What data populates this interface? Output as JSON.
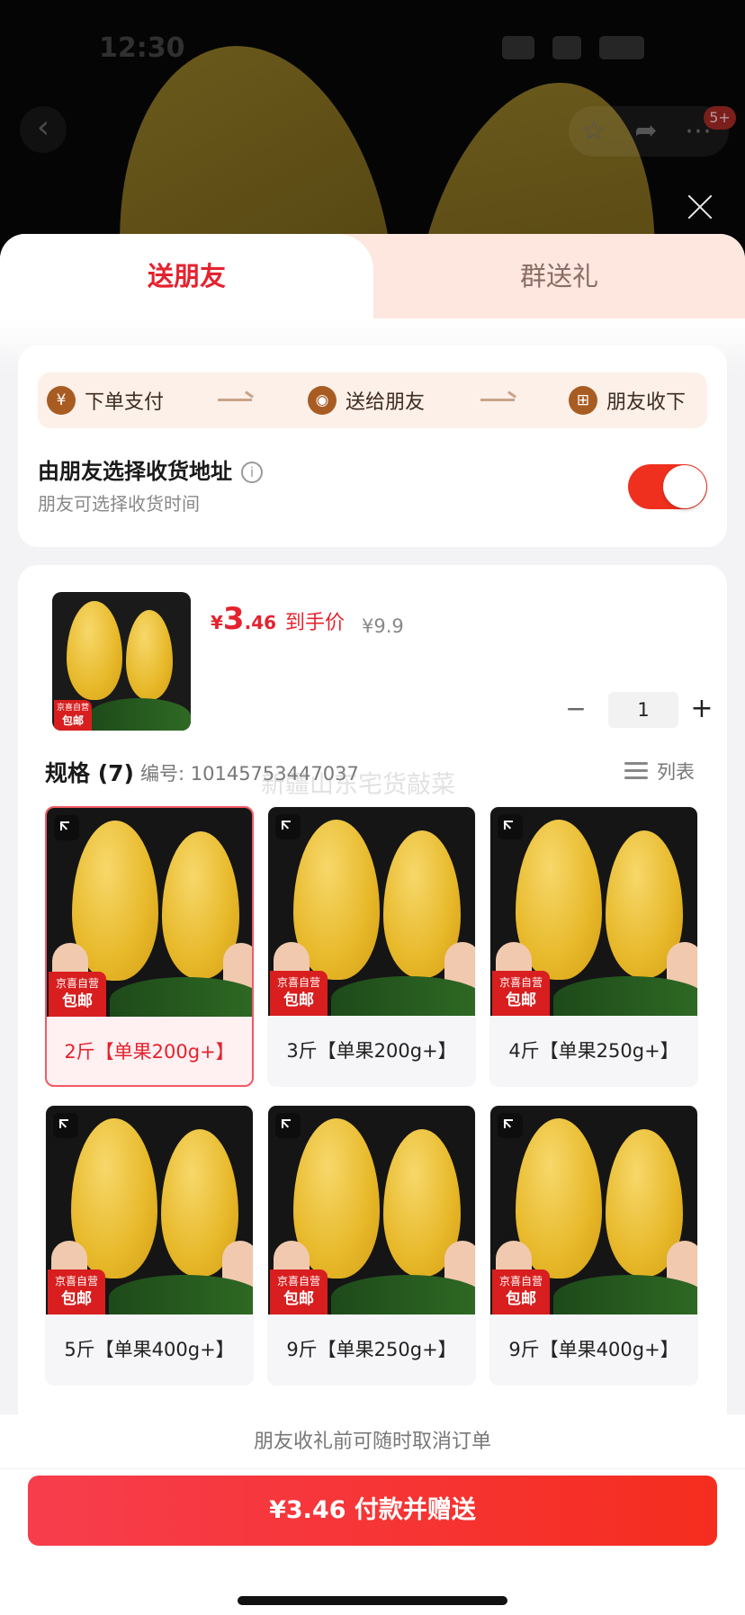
{
  "status_bar": {
    "time": "12:30"
  },
  "background": {
    "cart_badge": "5+"
  },
  "tabs": [
    {
      "label": "送朋友",
      "active": true
    },
    {
      "label": "群送礼",
      "active": false
    }
  ],
  "flow": [
    {
      "icon": "yen-circle-icon",
      "glyph": "¥",
      "label": "下单支付"
    },
    {
      "icon": "wechat-icon",
      "glyph": "◉",
      "label": "送给朋友"
    },
    {
      "icon": "gift-icon",
      "glyph": "⊞",
      "label": "朋友收下"
    }
  ],
  "address": {
    "title": "由朋友选择收货地址",
    "subtitle": "朋友可选择收货时间",
    "toggle_on": true
  },
  "product": {
    "price_currency": "¥",
    "price_int": "3",
    "price_dec": ".46",
    "price_label": "到手价",
    "original_price": "¥9.9",
    "quantity": "1",
    "qty_minus": "−",
    "qty_plus": "+"
  },
  "spec": {
    "title": "规格 (7)",
    "id_label": "编号: 10145753447037",
    "list_label": "列表",
    "watermark": "新疆山东宅货敲菜"
  },
  "badge": {
    "top": "京喜自营",
    "bottom": "包邮"
  },
  "skus": [
    {
      "label": "2斤【单果200g+】",
      "selected": true
    },
    {
      "label": "3斤【单果200g+】",
      "selected": false
    },
    {
      "label": "4斤【单果250g+】",
      "selected": false
    },
    {
      "label": "5斤【单果400g+】",
      "selected": false
    },
    {
      "label": "9斤【单果250g+】",
      "selected": false
    },
    {
      "label": "9斤【单果400g+】",
      "selected": false
    }
  ],
  "footer": {
    "note": "朋友收礼前可随时取消订单",
    "pay_button": "¥3.46 付款并赠送"
  },
  "colors": {
    "accent": "#e4232f",
    "pay_gradient_start": "#f73d4d",
    "pay_gradient_end": "#f52d1f",
    "flow_bg": "#fdf0e8",
    "toggle_on": "#f0301f"
  }
}
